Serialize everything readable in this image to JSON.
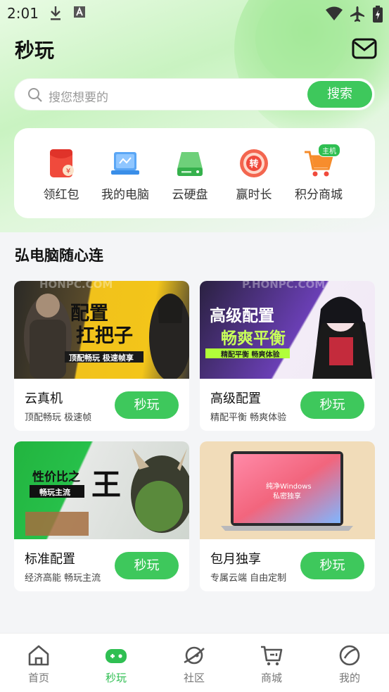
{
  "status_bar": {
    "time": "2:01"
  },
  "header": {
    "title": "秒玩"
  },
  "search": {
    "placeholder": "搜您想要的",
    "button_label": "搜索"
  },
  "shortcuts": [
    {
      "label": "领红包",
      "icon": "red-envelope-icon"
    },
    {
      "label": "我的电脑",
      "icon": "laptop-icon"
    },
    {
      "label": "云硬盘",
      "icon": "cloud-disk-icon"
    },
    {
      "label": "赢时长",
      "icon": "spin-wheel-icon",
      "glyph": "转"
    },
    {
      "label": "积分商城",
      "icon": "shopping-cart-icon",
      "badge": "主机"
    }
  ],
  "section": {
    "title": "弘电脑随心连"
  },
  "cards": [
    {
      "title": "云真机",
      "subtitle": "顶配畅玩 极速帧",
      "button": "秒玩",
      "banner": {
        "headline1": "配置",
        "headline2": "扛把子",
        "tag": "顶配畅玩 极速帧享",
        "watermark": "HONPC.COM"
      }
    },
    {
      "title": "高级配置",
      "subtitle": "精配平衡 畅爽体验",
      "button": "秒玩",
      "banner": {
        "headline1": "高级配置",
        "headline2": "畅爽平衡",
        "tag": "精配平衡 畅爽体验",
        "watermark": "P.HONPC.COM"
      }
    },
    {
      "title": "标准配置",
      "subtitle": "经济高能 畅玩主流",
      "button": "秒玩",
      "banner": {
        "headline1": "性价比之",
        "headline2": "王",
        "tag": "畅玩主流"
      }
    },
    {
      "title": "包月独享",
      "subtitle": "专属云端 自由定制",
      "button": "秒玩",
      "banner": {
        "line1": "纯净Windows",
        "line2": "私密独享"
      }
    }
  ],
  "bottom_nav": [
    {
      "label": "首页",
      "icon": "home-icon",
      "active": false
    },
    {
      "label": "秒玩",
      "icon": "gamepad-icon",
      "active": true
    },
    {
      "label": "社区",
      "icon": "planet-icon",
      "active": false
    },
    {
      "label": "商城",
      "icon": "cart-icon",
      "active": false
    },
    {
      "label": "我的",
      "icon": "profile-icon",
      "active": false
    }
  ],
  "colors": {
    "accent": "#3ec85c",
    "background": "#f4f5f7"
  }
}
